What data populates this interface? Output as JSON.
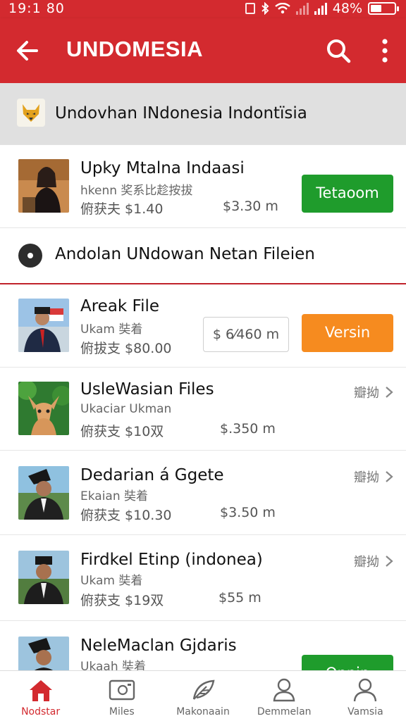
{
  "status_bar": {
    "time": "19:1 80",
    "battery": "48%",
    "battery_level": 0.48
  },
  "app_bar": {
    "title": "UNDOMESIA"
  },
  "sections": [
    {
      "label": "Undovhan INdonesia Indontïsia"
    },
    {
      "label": "Andolan UNdowan Netan Fileien"
    }
  ],
  "rows": [
    {
      "name": "Upky Mtalna Indaasi",
      "sub": "hkenn 奖系比趁按拔",
      "price1": "俯获夫 $1.40",
      "price2": "$3.30 m",
      "button": "Tetaoom"
    },
    {
      "name": "Areak File",
      "sub": "Ukam 奘着",
      "price1": "俯拔支 $80.00",
      "price_box": "$ 6⁄460 m",
      "button": "Versin"
    },
    {
      "name": "UsleWasian Files",
      "sub": "Ukaciar Ukman",
      "price1": "俯获支 $10双",
      "price2": "$.350 m",
      "action": "瓣拗"
    },
    {
      "name": "Dedarian á Ggete",
      "sub": "Ekaian 奘着",
      "price1": "俯获支 $10.30",
      "price2": "$3.50 m",
      "action": "瓣拗"
    },
    {
      "name": "Firdkel Etinp (indonea)",
      "sub": "Ukam 奘着",
      "price1": "俯获支 $19双",
      "price2": "$55 m",
      "action": "瓣拗"
    },
    {
      "name": "NeleMaclan Gjdaris",
      "sub": "Ukaah 奘着",
      "button": "Oppin"
    }
  ],
  "bottom_nav": [
    {
      "label": "Nodstar",
      "icon": "home-icon",
      "active": true
    },
    {
      "label": "Miles",
      "icon": "image-icon",
      "active": false
    },
    {
      "label": "Makonaain",
      "icon": "feather-icon",
      "active": false
    },
    {
      "label": "Demmelan",
      "icon": "person-icon",
      "active": false
    },
    {
      "label": "Vamsia",
      "icon": "profile-icon",
      "active": false
    }
  ],
  "colors": {
    "primary": "#d32a2f",
    "green": "#1f9c2c",
    "orange": "#f68b1f"
  }
}
